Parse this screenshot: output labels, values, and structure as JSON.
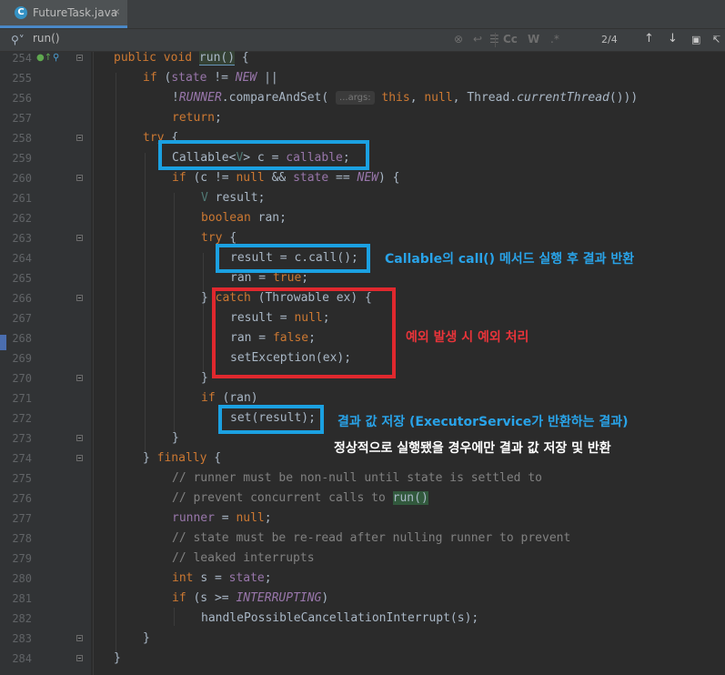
{
  "editor_tab": {
    "label": "FutureTask.java",
    "close": "×",
    "icon": "C"
  },
  "search": {
    "value": "run()",
    "match_case": "Cc",
    "words": "W",
    "result": "2/4"
  },
  "code_lines": [
    {
      "n": "254"
    },
    {
      "n": "255"
    },
    {
      "n": "256"
    },
    {
      "n": "257"
    },
    {
      "n": "258"
    },
    {
      "n": "259"
    },
    {
      "n": "260"
    },
    {
      "n": "261"
    },
    {
      "n": "262"
    },
    {
      "n": "263"
    },
    {
      "n": "264"
    },
    {
      "n": "265"
    },
    {
      "n": "266"
    },
    {
      "n": "267"
    },
    {
      "n": "268"
    },
    {
      "n": "269"
    },
    {
      "n": "270"
    },
    {
      "n": "271"
    },
    {
      "n": "272"
    },
    {
      "n": "273"
    },
    {
      "n": "274"
    },
    {
      "n": "275"
    },
    {
      "n": "276"
    },
    {
      "n": "277"
    },
    {
      "n": "278"
    },
    {
      "n": "279"
    },
    {
      "n": "280"
    },
    {
      "n": "281"
    },
    {
      "n": "282"
    },
    {
      "n": "283"
    },
    {
      "n": "284"
    }
  ],
  "param_hint": "...args:",
  "annotations": {
    "call_note": "Callable의 call() 메서드 실행 후 결과 반환",
    "exception_note": "예외 발생 시 예외 처리",
    "set_note": "결과 값 저장 (ExecutorService가 반환하는 결과)",
    "normal_note": "정상적으로 실행됐을 경우에만 결과 값 저장 및 반환"
  },
  "colors": {
    "blue_box": "#1ba1e2",
    "red_box": "#e0282e",
    "blue_text": "#29a3e8",
    "red_text": "#e8343a",
    "white_text": "#ffffff"
  }
}
